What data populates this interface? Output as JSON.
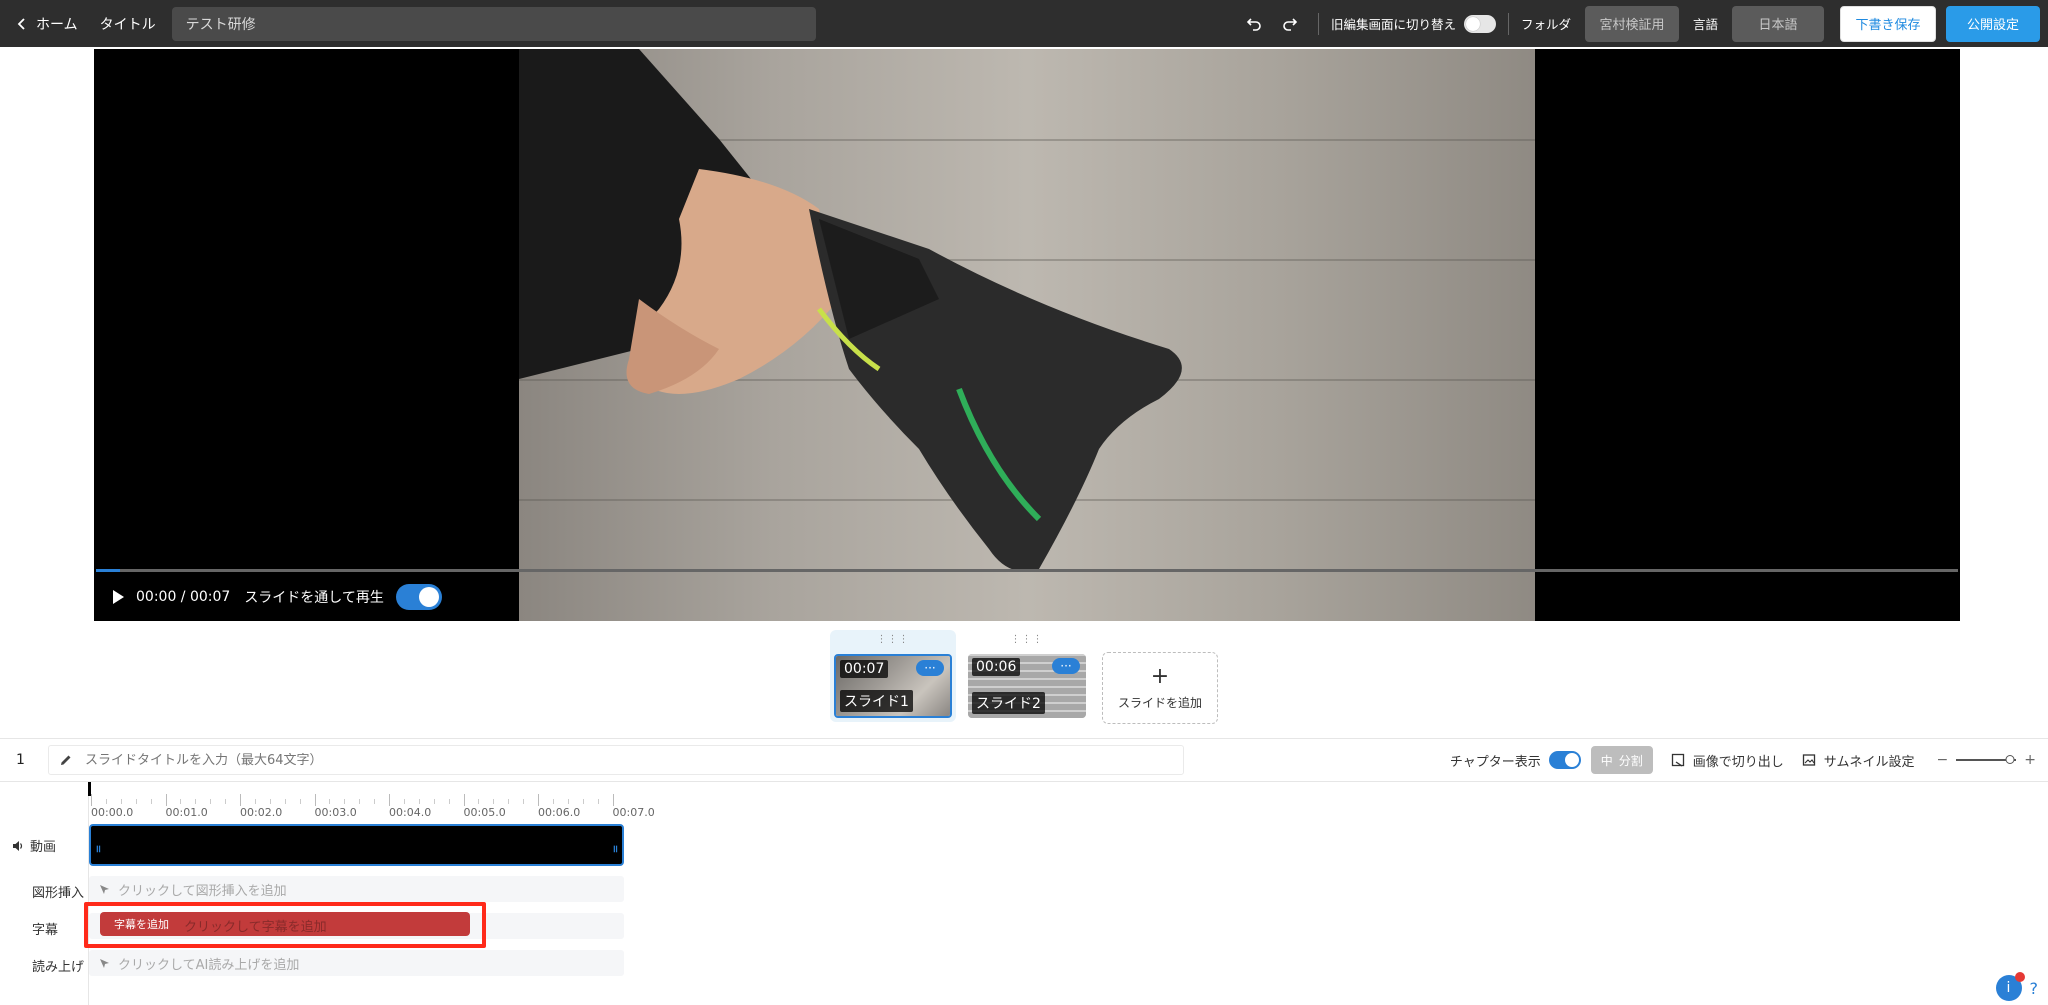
{
  "header": {
    "home_label": "ホーム",
    "title_label": "タイトル",
    "title_value": "テスト研修",
    "old_editor_label": "旧編集画面に切り替え",
    "folder_label": "フォルダ",
    "folder_value": "宮村検証用",
    "language_label": "言語",
    "language_value": "日本語",
    "save_draft_label": "下書き保存",
    "publish_settings_label": "公開設定"
  },
  "player": {
    "time_display": "00:00 / 00:07",
    "play_through_label": "スライドを通して再生",
    "play_through_on": true,
    "progress_fraction": 0.013
  },
  "slides": [
    {
      "time": "00:07",
      "name": "スライド1",
      "more": "···",
      "active": true
    },
    {
      "time": "00:06",
      "name": "スライド2",
      "more": "···",
      "active": false
    }
  ],
  "add_slide": {
    "plus": "+",
    "label": "スライドを追加"
  },
  "slide_row": {
    "number": "1",
    "title_placeholder": "スライドタイトルを入力（最大64文字）",
    "chapter_label": "チャプター表示",
    "chapter_on": true,
    "split_label": "分割",
    "split_icon": "中",
    "crop_label": "画像で切り出し",
    "thumbnail_label": "サムネイル設定",
    "zoom_minus": "−",
    "zoom_plus": "+",
    "zoom_level": 0.9
  },
  "timeline": {
    "ticks": [
      "00:00.0",
      "00:01.0",
      "00:02.0",
      "00:03.0",
      "00:04.0",
      "00:05.0",
      "00:06.0",
      "00:07.0"
    ],
    "tracks": {
      "video": "動画",
      "shapes": "図形挿入",
      "captions": "字幕",
      "narration": "読み上げ"
    },
    "shapes_hint": "クリックして図形挿入を追加",
    "caption_button": "字幕を追加",
    "caption_hint": "クリックして字幕を追加",
    "narration_hint": "クリックしてAI読み上げを追加"
  },
  "help": {
    "icon": "i",
    "question": "?"
  },
  "colors": {
    "accent": "#2a80d6",
    "highlight": "#ff2a1a",
    "caption": "#c23b3b"
  }
}
